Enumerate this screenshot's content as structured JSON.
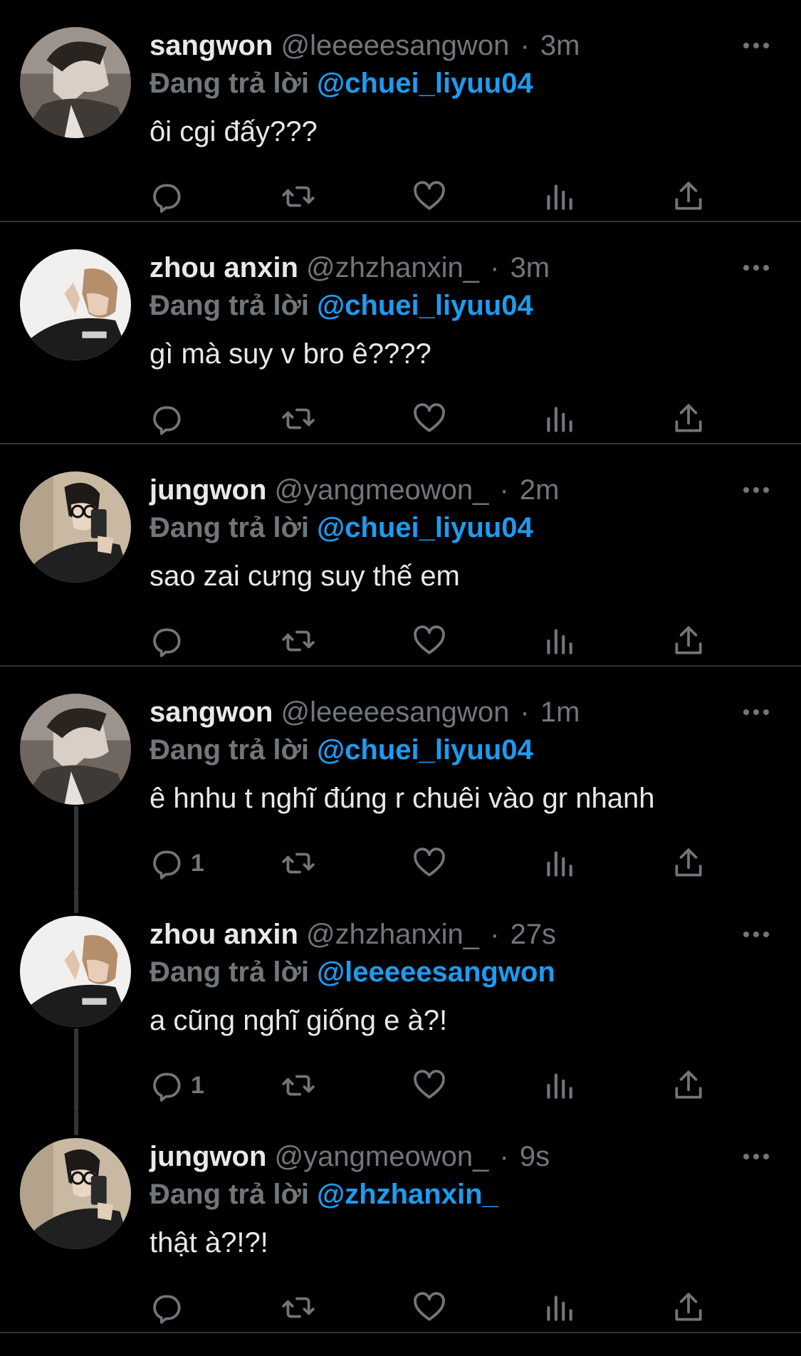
{
  "reply_context_label": "Đang trả lời",
  "tweets": [
    {
      "name": "sangwon",
      "handle": "@leeeeesangwon",
      "dot": "·",
      "time": "3m",
      "reply_to": "@chuei_liyuu04",
      "text": "ôi cgi đấy???",
      "reply_count": ""
    },
    {
      "name": "zhou anxin",
      "handle": "@zhzhanxin_",
      "dot": "·",
      "time": "3m",
      "reply_to": "@chuei_liyuu04",
      "text": "gì mà suy v bro ê????",
      "reply_count": ""
    },
    {
      "name": "jungwon",
      "handle": "@yangmeowon_",
      "dot": "·",
      "time": "2m",
      "reply_to": "@chuei_liyuu04",
      "text": "sao zai cưng suy thế em",
      "reply_count": ""
    },
    {
      "name": "sangwon",
      "handle": "@leeeeesangwon",
      "dot": "·",
      "time": "1m",
      "reply_to": "@chuei_liyuu04",
      "text": "ê hnhu t nghĩ đúng r chuêi vào gr nhanh",
      "reply_count": "1"
    },
    {
      "name": "zhou anxin",
      "handle": "@zhzhanxin_",
      "dot": "·",
      "time": "27s",
      "reply_to": "@leeeeesangwon",
      "text": "a cũng nghĩ giống e à?!",
      "reply_count": "1"
    },
    {
      "name": "jungwon",
      "handle": "@yangmeowon_",
      "dot": "·",
      "time": "9s",
      "reply_to": "@zhzhanxin_",
      "text": "thật à?!?!",
      "reply_count": ""
    }
  ],
  "icons": {
    "avatar": "profile-photo",
    "more": "more-dots-icon",
    "reply": "reply-bubble-icon",
    "retweet": "retweet-icon",
    "like": "heart-icon",
    "views": "views-bar-chart-icon",
    "share": "share-upload-icon"
  },
  "colors": {
    "background": "#000000",
    "text": "#e7e9ea",
    "secondary": "#71767b",
    "link": "#1d9bf0",
    "divider": "#2f3336"
  }
}
